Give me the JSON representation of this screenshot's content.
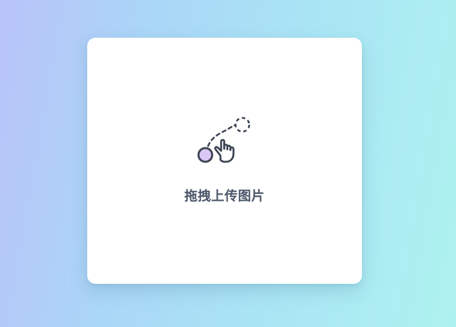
{
  "upload": {
    "label": "拖拽上传图片",
    "icon": "drag-gesture-icon"
  },
  "colors": {
    "icon_stroke": "#3d4452",
    "ball_fill": "#dcc6f5",
    "label_text": "#4a5568",
    "card_background": "#ffffff",
    "background_gradient_start": "#b9c3f9",
    "background_gradient_end": "#aef2ef"
  }
}
